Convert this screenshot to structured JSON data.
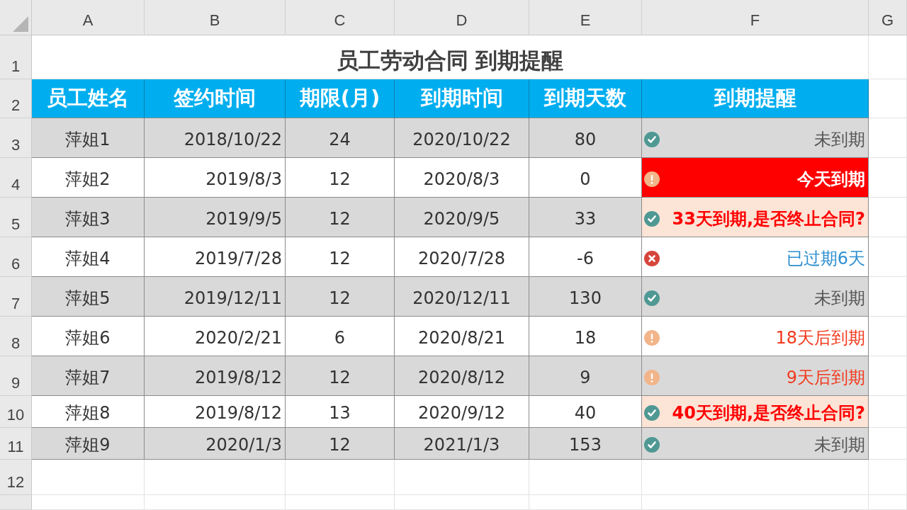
{
  "columns": [
    "A",
    "B",
    "C",
    "D",
    "E",
    "F",
    "G"
  ],
  "row_numbers": [
    "1",
    "2",
    "3",
    "4",
    "5",
    "6",
    "7",
    "8",
    "9",
    "10",
    "11",
    "12"
  ],
  "title": "员工劳动合同 到期提醒",
  "headers": [
    "员工姓名",
    "签约时间",
    "期限(月)",
    "到期时间",
    "到期天数",
    "到期提醒"
  ],
  "rows": [
    {
      "shaded": true,
      "name": "萍姐1",
      "signed": "2018/10/22",
      "term": "24",
      "expiry": "2020/10/22",
      "days": "80",
      "alert": {
        "kind": "ok",
        "text": "未到期"
      }
    },
    {
      "shaded": false,
      "name": "萍姐2",
      "signed": "2019/8/3",
      "term": "12",
      "expiry": "2020/8/3",
      "days": "0",
      "alert": {
        "kind": "today",
        "text": "今天到期"
      }
    },
    {
      "shaded": true,
      "name": "萍姐3",
      "signed": "2019/9/5",
      "term": "12",
      "expiry": "2020/9/5",
      "days": "33",
      "alert": {
        "kind": "warn",
        "text": "33天到期,是否终止合同?"
      }
    },
    {
      "shaded": false,
      "name": "萍姐4",
      "signed": "2019/7/28",
      "term": "12",
      "expiry": "2020/7/28",
      "days": "-6",
      "alert": {
        "kind": "expired",
        "text": "已过期6天"
      }
    },
    {
      "shaded": true,
      "name": "萍姐5",
      "signed": "2019/12/11",
      "term": "12",
      "expiry": "2020/12/11",
      "days": "130",
      "alert": {
        "kind": "ok",
        "text": "未到期"
      }
    },
    {
      "shaded": false,
      "name": "萍姐6",
      "signed": "2020/2/21",
      "term": "6",
      "expiry": "2020/8/21",
      "days": "18",
      "alert": {
        "kind": "soon",
        "text": "18天后到期"
      }
    },
    {
      "shaded": true,
      "name": "萍姐7",
      "signed": "2019/8/12",
      "term": "12",
      "expiry": "2020/8/12",
      "days": "9",
      "alert": {
        "kind": "soon",
        "text": "9天后到期"
      }
    },
    {
      "shaded": false,
      "name": "萍姐8",
      "signed": "2019/8/12",
      "term": "13",
      "expiry": "2020/9/12",
      "days": "40",
      "alert": {
        "kind": "warn",
        "text": "40天到期,是否终止合同?"
      }
    },
    {
      "shaded": true,
      "name": "萍姐9",
      "signed": "2020/1/3",
      "term": "12",
      "expiry": "2021/1/3",
      "days": "153",
      "alert": {
        "kind": "ok",
        "text": "未到期"
      }
    }
  ]
}
